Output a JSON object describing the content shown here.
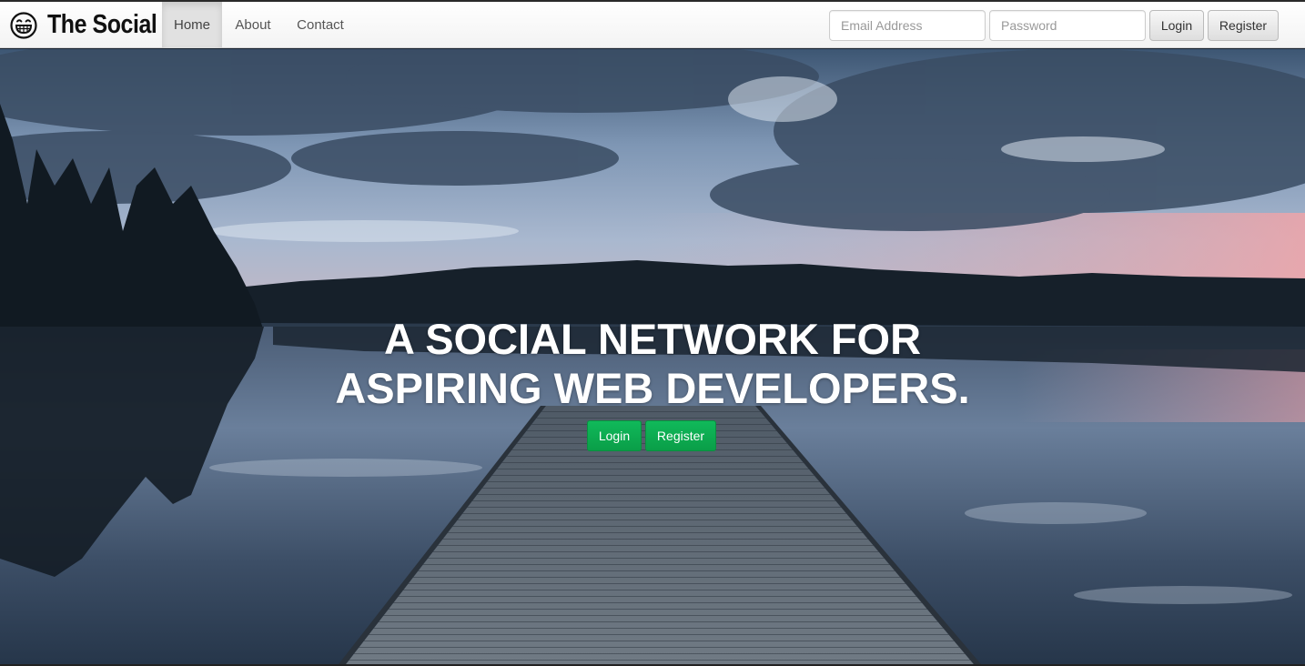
{
  "brand": {
    "name": "The Social",
    "icon": "grinning-face-icon"
  },
  "nav": {
    "items": [
      {
        "label": "Home",
        "active": true
      },
      {
        "label": "About",
        "active": false
      },
      {
        "label": "Contact",
        "active": false
      }
    ]
  },
  "login_form": {
    "email_placeholder": "Email Address",
    "password_placeholder": "Password",
    "login_label": "Login",
    "register_label": "Register"
  },
  "hero": {
    "headline_line1": "A SOCIAL NETWORK FOR",
    "headline_line2": "ASPIRING WEB DEVELOPERS.",
    "login_label": "Login",
    "register_label": "Register"
  },
  "colors": {
    "cta_green": "#0fb155",
    "navbar_bg": "#f8f8f8",
    "active_nav_bg": "#e1e1e1"
  }
}
